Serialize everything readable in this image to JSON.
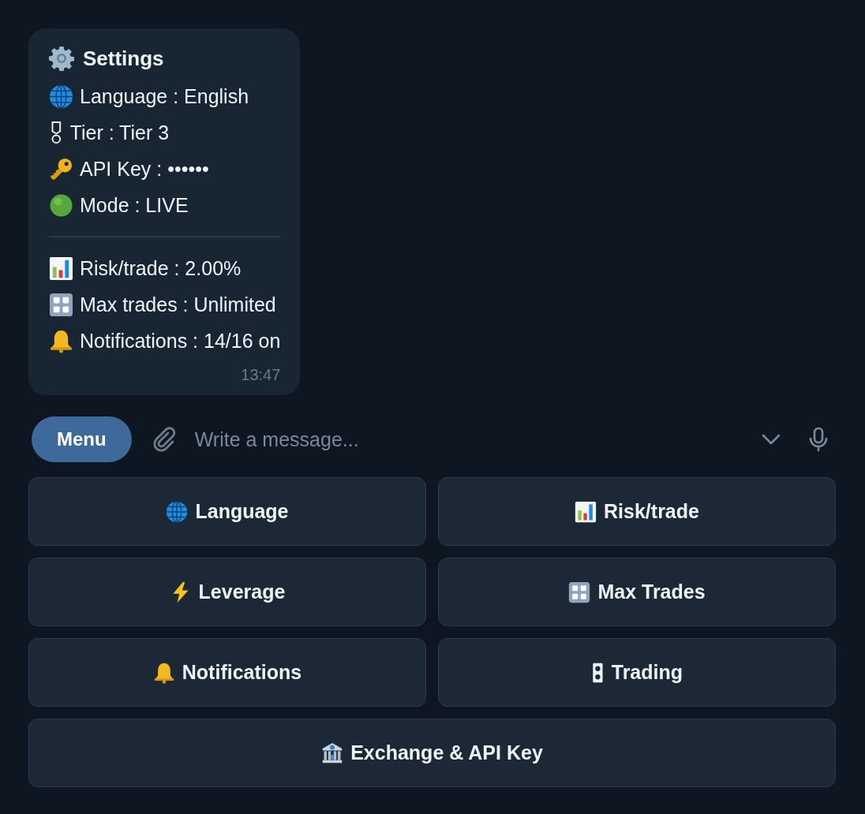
{
  "message": {
    "title": "Settings",
    "sections": [
      {
        "lines": [
          {
            "kind": "language",
            "text": "Language : English"
          },
          {
            "kind": "tier",
            "text": "Tier : Tier 3"
          },
          {
            "kind": "apikey",
            "text": "API Key : ••••••"
          },
          {
            "kind": "mode",
            "text": "Mode : LIVE"
          }
        ]
      },
      {
        "lines": [
          {
            "kind": "risk",
            "text": "Risk/trade : 2.00%"
          },
          {
            "kind": "maxtrades",
            "text": "Max trades : Unlimited"
          },
          {
            "kind": "notifications",
            "text": "Notifications : 14/16 on"
          }
        ]
      }
    ],
    "time": "13:47"
  },
  "composer": {
    "menu_button": "Menu",
    "placeholder": "Write a message..."
  },
  "keyboard": {
    "rows": [
      [
        {
          "kind": "language",
          "label": "Language"
        },
        {
          "kind": "risk",
          "label": "Risk/trade"
        }
      ],
      [
        {
          "kind": "leverage",
          "label": "Leverage"
        },
        {
          "kind": "maxtrades",
          "label": "Max Trades"
        }
      ],
      [
        {
          "kind": "notifications",
          "label": "Notifications"
        },
        {
          "kind": "trading",
          "label": "Trading"
        }
      ],
      [
        {
          "kind": "exchange",
          "label": "Exchange & API Key"
        }
      ]
    ]
  }
}
